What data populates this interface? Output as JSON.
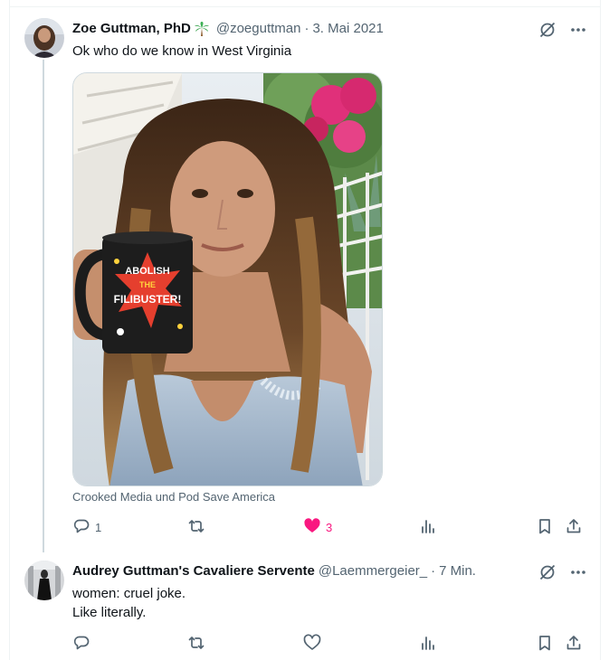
{
  "tweet": {
    "author_name": "Zoe Guttman, PhD",
    "author_handle": "@zoeguttman",
    "timestamp": "3. Mai 2021",
    "text": "Ok who do we know in West Virginia",
    "media_credit": "Crooked Media und Pod Save America",
    "mug_text": [
      "ABOLISH",
      "THE",
      "FILIBUSTER!"
    ],
    "reply_count": "1",
    "retweet_count": "",
    "like_count": "3",
    "liked": true
  },
  "reply": {
    "author_name": "Audrey Guttman's Cavaliere Servente",
    "author_handle": "@Laemmergeier_",
    "timestamp": "7 Min.",
    "text_line1": "women: cruel joke.",
    "text_line2": "Like literally."
  },
  "icons": {
    "emoji": "palm-tree-icon",
    "grok": "grok-icon",
    "more": "more-icon",
    "reply": "reply-icon",
    "retweet": "retweet-icon",
    "like": "heart-icon",
    "views": "views-icon",
    "bookmark": "bookmark-icon",
    "share": "share-icon"
  },
  "colors": {
    "like_active": "#f91880",
    "secondary_text": "#536471",
    "thread_line": "#cfd9de"
  }
}
